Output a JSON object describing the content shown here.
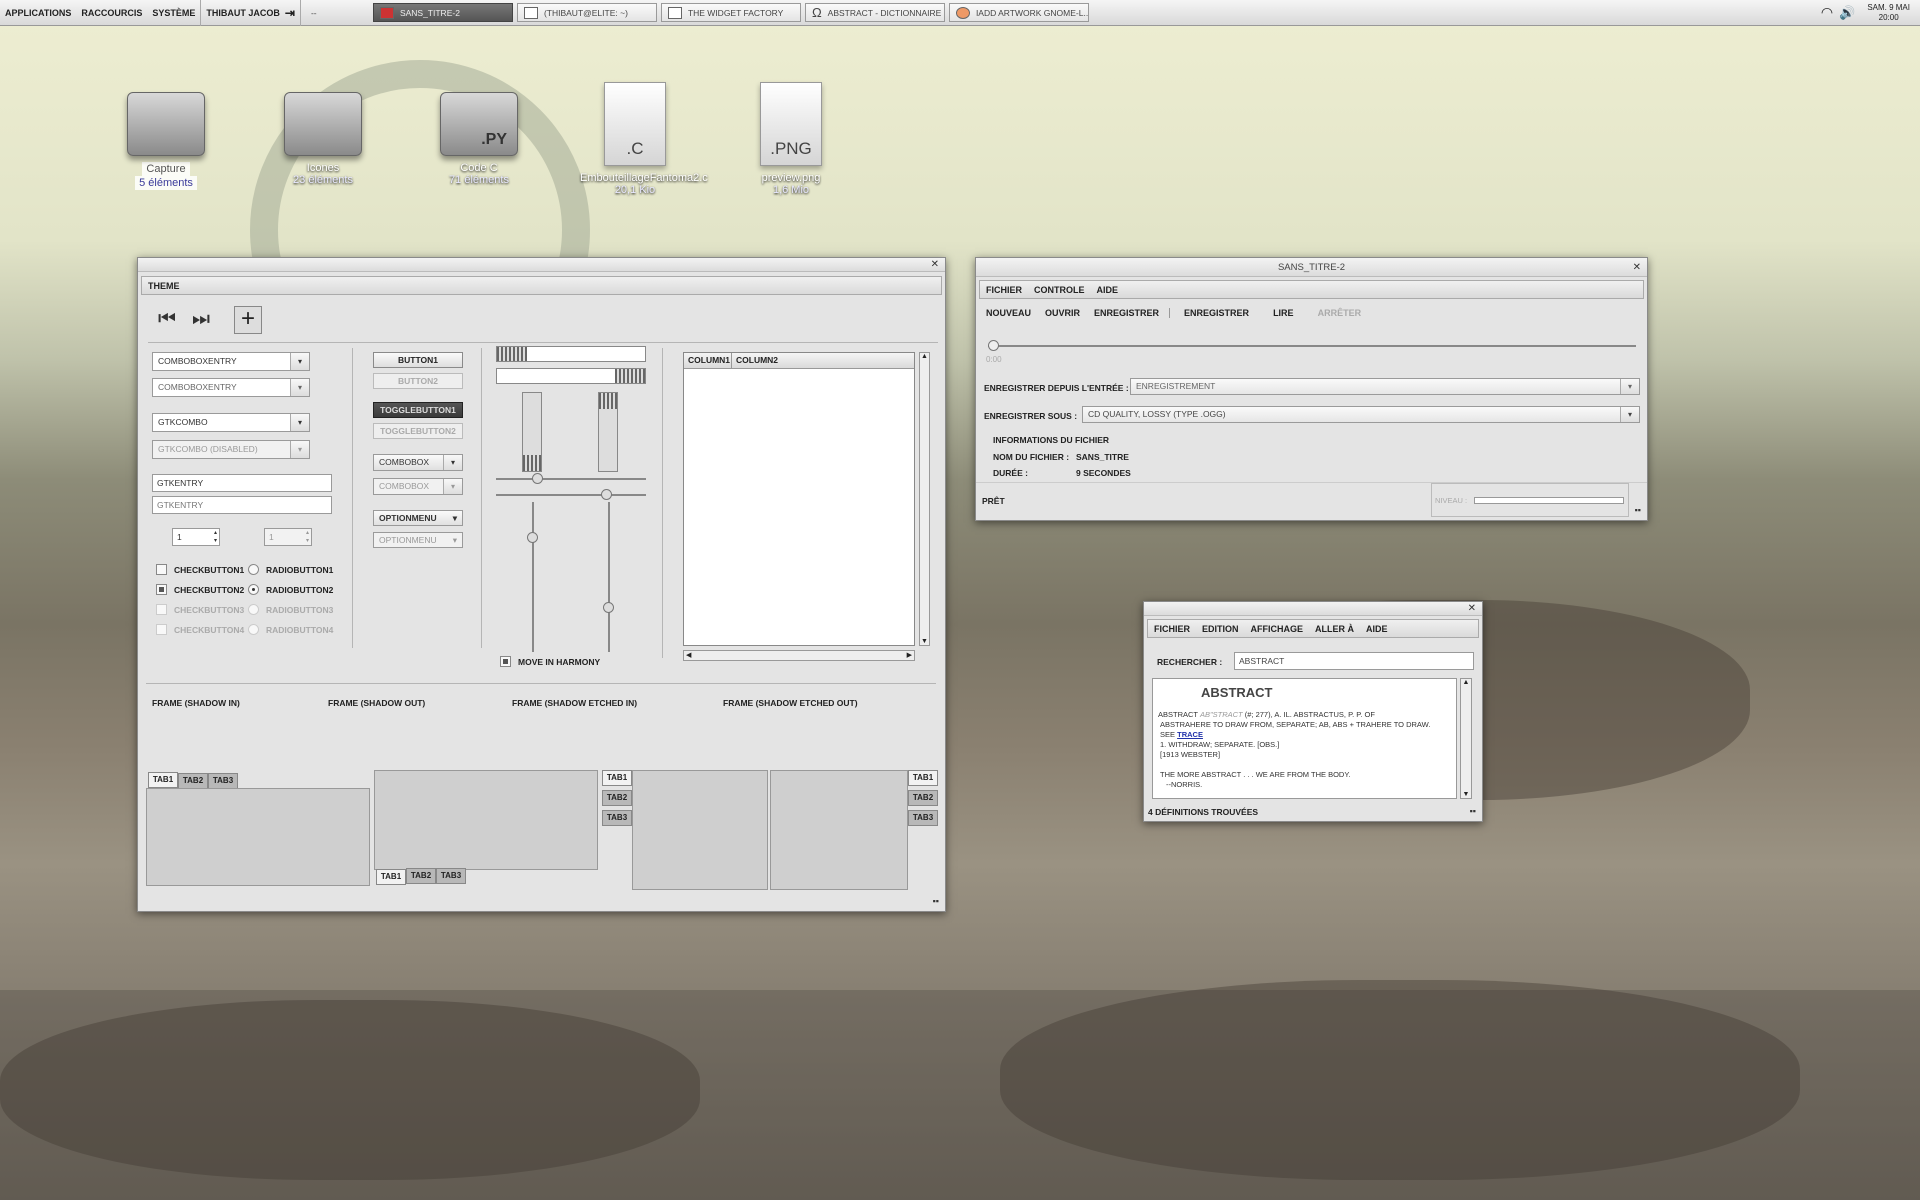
{
  "panel": {
    "menus": [
      "APPLICATIONS",
      "RACCOURCIS",
      "SYSTÈME"
    ],
    "user": "THIBAUT JACOB",
    "blank": "--",
    "tasks": [
      "SANS_TITRE-2",
      "(THIBAUT@ELITE: ~)",
      "THE WIDGET FACTORY",
      "ABSTRACT - DICTIONNAIRE",
      "IADD ARTWORK GNOME-L..."
    ],
    "clock_day": "SAM. 9 MAI",
    "clock_time": "20:00"
  },
  "desktop": [
    {
      "name": "Capture",
      "sub": "5 éléments",
      "kind": "folder",
      "tag": ""
    },
    {
      "name": "Icones",
      "sub": "23 éléments",
      "kind": "folder",
      "tag": ""
    },
    {
      "name": "Code C",
      "sub": "71 éléments",
      "kind": "folder",
      "tag": ".PY"
    },
    {
      "name": "EmbouteillageFantoma2.c",
      "sub": "20,1 Kio",
      "kind": "file",
      "tag": ".C"
    },
    {
      "name": "preview.png",
      "sub": "1,6 Mio",
      "kind": "file",
      "tag": ".PNG"
    }
  ],
  "widget_factory": {
    "menu": "THEME",
    "combos": [
      "COMBOBOXENTRY",
      "COMBOBOXENTRY",
      "GTKCOMBO",
      "GTKCOMBO (DISABLED)"
    ],
    "entries": [
      "GTKENTRY",
      "GTKENTRY"
    ],
    "spin": [
      "1",
      "1"
    ],
    "checks": [
      "CHECKBUTTON1",
      "CHECKBUTTON2",
      "CHECKBUTTON3",
      "CHECKBUTTON4"
    ],
    "radios": [
      "RADIOBUTTON1",
      "RADIOBUTTON2",
      "RADIOBUTTON3",
      "RADIOBUTTON4"
    ],
    "buttons": [
      "BUTTON1",
      "BUTTON2",
      "TOGGLEBUTTON1",
      "TOGGLEBUTTON2"
    ],
    "comboboxes": [
      "COMBOBOX",
      "COMBOBOX"
    ],
    "optionmenus": [
      "OPTIONMENU",
      "OPTIONMENU"
    ],
    "harmony": "MOVE IN HARMONY",
    "columns": [
      "COLUMN1",
      "COLUMN2"
    ],
    "frames": [
      "FRAME (SHADOW IN)",
      "FRAME (SHADOW OUT)",
      "FRAME (SHADOW ETCHED IN)",
      "FRAME (SHADOW ETCHED OUT)"
    ],
    "tabs": [
      "TAB1",
      "TAB2",
      "TAB3"
    ]
  },
  "recorder": {
    "title": "SANS_TITRE-2",
    "menus": [
      "FICHIER",
      "CONTROLE",
      "AIDE"
    ],
    "toolbar": [
      "NOUVEAU",
      "OUVRIR",
      "ENREGISTRER",
      "ENREGISTRER",
      "LIRE",
      "ARRÊTER"
    ],
    "time": "0:00",
    "record_from_label": "ENREGISTRER DEPUIS L'ENTRÉE :",
    "record_from_value": "ENREGISTREMENT",
    "record_as_label": "ENREGISTRER SOUS :",
    "record_as_value": "CD QUALITY, LOSSY (TYPE .OGG)",
    "info_title": "INFORMATIONS DU FICHIER",
    "filename_label": "NOM DU FICHIER :",
    "filename_value": "SANS_TITRE",
    "duration_label": "DURÉE :",
    "duration_value": "9 SECONDES",
    "status": "PRÊT",
    "level_label": "NIVEAU :"
  },
  "dictionary": {
    "menus": [
      "FICHIER",
      "EDITION",
      "AFFICHAGE",
      "ALLER À",
      "AIDE"
    ],
    "search_label": "RECHERCHER :",
    "search_value": "ABSTRACT",
    "heading": "ABSTRACT",
    "line1a": "ABSTRACT",
    "line1b": "AB\"STRACT",
    "line1c": "(#; 277), A. IL. ABSTRACTUS, P. P. OF",
    "line2": "ABSTRAHERE TO DRAW FROM, SEPARATE; AB, ABS + TRAHERE TO DRAW.",
    "line3a": "SEE",
    "line3link": "TRACE",
    "line4": "1. WITHDRAW; SEPARATE. [OBS.]",
    "line5": "[1913 WEBSTER]",
    "line6": "THE MORE ABSTRACT . . . WE ARE FROM THE BODY.",
    "line7": "--NORRIS.",
    "status": "4 DÉFINITIONS TROUVÉES"
  },
  "colors": {
    "accent": "#555555",
    "link": "#2233aa"
  }
}
